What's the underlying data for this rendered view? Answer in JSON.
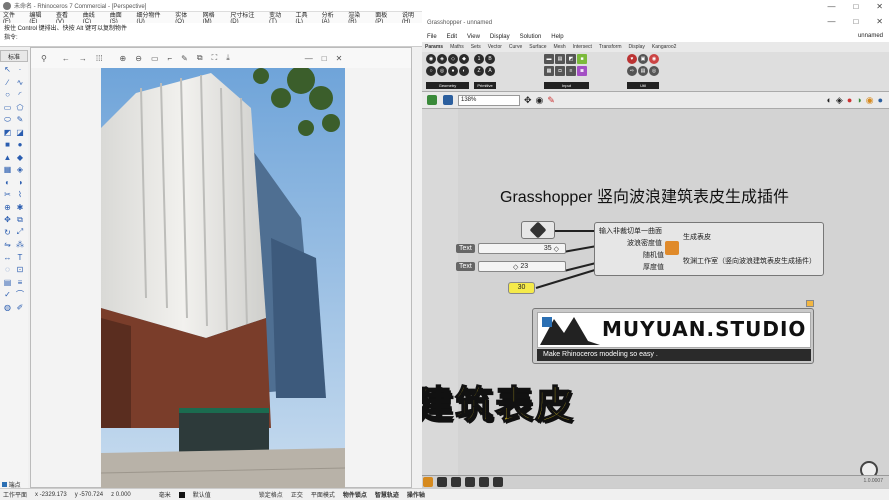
{
  "rhino": {
    "title": "未命名 - Rhinoceros 7 Commercial - [Perspective]",
    "menu": [
      "文件(F)",
      "编辑(E)",
      "查看(V)",
      "曲线(C)",
      "曲面(S)",
      "细分物件(U)",
      "实体(O)",
      "网格(M)",
      "尺寸标注(D)",
      "变动(T)",
      "工具(L)",
      "分析(A)",
      "渲染(R)",
      "面板(P)",
      "说明(H)"
    ],
    "cmd_line1": "按住 Control 键排出、快按 Alt 键可以复制物件",
    "cmd_prompt": "指令:",
    "panel_tab": "标准"
  },
  "status": {
    "cplane": "工作平面",
    "x": "x -2329.173",
    "y": "y -570.724",
    "z": "z 0.000",
    "unit": "毫米",
    "layer": "默认值",
    "items": [
      "锁定格点",
      "正交",
      "平面模式",
      "物件锁点",
      "智慧轨迹",
      "操作轴"
    ],
    "snap_end": "端点"
  },
  "gh": {
    "title": "Grasshopper - unnamed",
    "menu": [
      "File",
      "Edit",
      "View",
      "Display",
      "Solution",
      "Help"
    ],
    "filename": "unnamed",
    "tabs": [
      "Params",
      "Maths",
      "Sets",
      "Vector",
      "Curve",
      "Surface",
      "Mesh",
      "Intersect",
      "Transform",
      "Display",
      "Kangaroo2"
    ],
    "ribbon_groups": [
      "Geometry",
      "Primitive",
      "Input",
      "Util"
    ],
    "zoom": "138%",
    "heading": "Grasshopper 竖向波浪建筑表皮生成插件",
    "component": {
      "inputs": [
        "输入非裁切单一曲面",
        "波浪密度值",
        "随机值",
        "厚度值"
      ],
      "outputs": [
        "生成表皮",
        "牧渊工作室（竖向波浪建筑表皮生成插件）"
      ]
    },
    "sliders": [
      {
        "label": "Text",
        "value": "35"
      },
      {
        "label": "Text",
        "value": "23"
      }
    ],
    "number_panel": "30",
    "logo_text": "MUYUAN.STUDIO",
    "logo_tagline": "Make Rhinoceros modeling so easy .",
    "version": "1.0.0007"
  },
  "caption": "竖向波浪建筑表皮"
}
